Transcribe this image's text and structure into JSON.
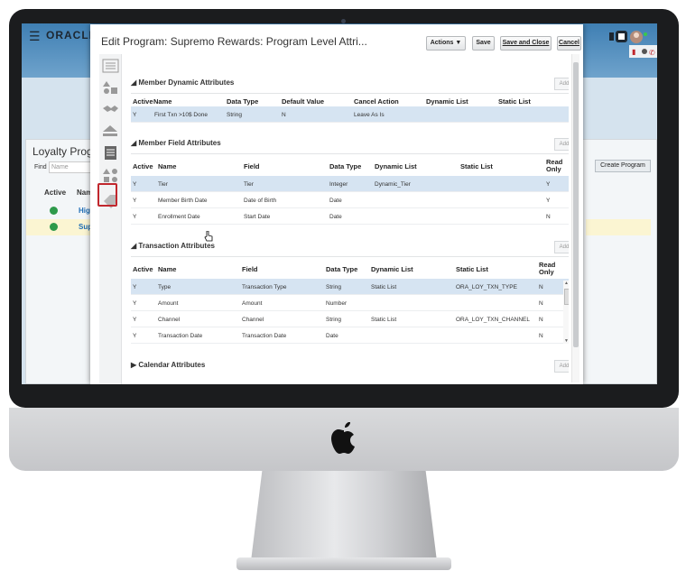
{
  "app": {
    "brand": "ORACLE",
    "menu_icon": "hamburger-icon"
  },
  "background_page": {
    "title": "Loyalty Progr",
    "find_label": "Find",
    "find_placeholder": "Name",
    "columns": [
      "Active",
      "Nam"
    ],
    "rows": [
      {
        "name": "High"
      },
      {
        "name": "Sup"
      }
    ],
    "create_button": "Create Program"
  },
  "dialog": {
    "title": "Edit Program: Supremo Rewards: Program Level Attri...",
    "buttons": {
      "actions": "Actions",
      "save": "Save",
      "save_close": "Save and Close",
      "cancel": "Cancel"
    },
    "sections": {
      "member_dynamic": {
        "title": "Member Dynamic Attributes",
        "add": "Add",
        "columns": [
          "Active",
          "Name",
          "Data Type",
          "Default Value",
          "Cancel Action",
          "Dynamic List",
          "Static List"
        ],
        "rows": [
          {
            "active": "Y",
            "name": "First Txn >10$ Done",
            "data_type": "String",
            "default_value": "N",
            "cancel_action": "Leave As Is",
            "dynamic_list": "",
            "static_list": ""
          }
        ]
      },
      "member_field": {
        "title": "Member Field Attributes",
        "add": "Add",
        "columns": [
          "Active",
          "Name",
          "Field",
          "Data Type",
          "Dynamic List",
          "Static List",
          "Read Only"
        ],
        "rows": [
          {
            "active": "Y",
            "name": "Tier",
            "field": "Tier",
            "data_type": "Integer",
            "dynamic_list": "Dynamic_Tier",
            "static_list": "",
            "read_only": "Y"
          },
          {
            "active": "Y",
            "name": "Member Birth Date",
            "field": "Date of Birth",
            "data_type": "Date",
            "dynamic_list": "",
            "static_list": "",
            "read_only": "Y"
          },
          {
            "active": "Y",
            "name": "Enrollment Date",
            "field": "Start Date",
            "data_type": "Date",
            "dynamic_list": "",
            "static_list": "",
            "read_only": "N"
          }
        ]
      },
      "transaction": {
        "title": "Transaction Attributes",
        "add": "Add",
        "columns": [
          "Active",
          "Name",
          "Field",
          "Data Type",
          "Dynamic List",
          "Static List",
          "Read Only"
        ],
        "rows": [
          {
            "active": "Y",
            "name": "Type",
            "field": "Transaction Type",
            "data_type": "String",
            "dynamic_list": "Static List",
            "static_list": "ORA_LOY_TXN_TYPE",
            "read_only": "N"
          },
          {
            "active": "Y",
            "name": "Amount",
            "field": "Amount",
            "data_type": "Number",
            "dynamic_list": "",
            "static_list": "",
            "read_only": "N"
          },
          {
            "active": "Y",
            "name": "Channel",
            "field": "Channel",
            "data_type": "String",
            "dynamic_list": "Static List",
            "static_list": "ORA_LOY_TXN_CHANNEL",
            "read_only": "N"
          },
          {
            "active": "Y",
            "name": "Transaction Date",
            "field": "Transaction Date",
            "data_type": "Date",
            "dynamic_list": "",
            "static_list": "",
            "read_only": "N"
          }
        ]
      },
      "calendar": {
        "title": "Calendar Attributes",
        "add": "Add"
      }
    }
  },
  "colors": {
    "selected_row": "#d6e4f2",
    "highlight_box": "#c1272d",
    "active_check": "#2e9a4b"
  }
}
